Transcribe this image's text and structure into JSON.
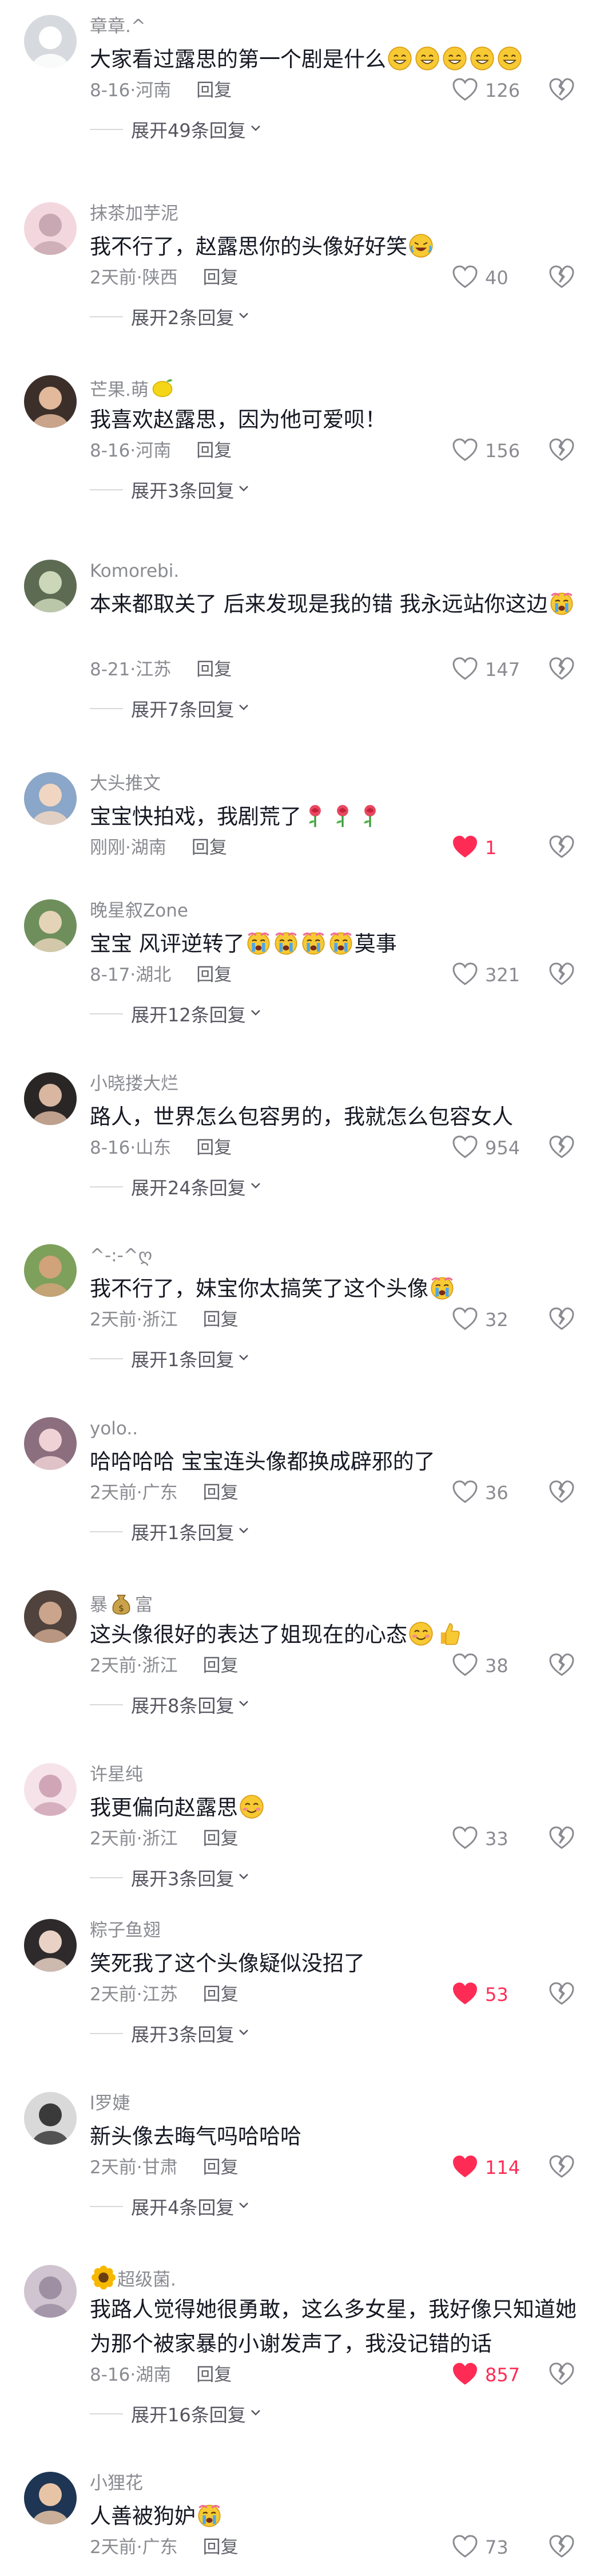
{
  "comments": [
    {
      "name": "章章.^",
      "text": "大家看过露思的第一个剧是什么",
      "emoji": [
        "grin",
        "grin",
        "grin",
        "grin",
        "grin"
      ],
      "time": "8-16",
      "region": "河南",
      "reply": "回复",
      "likes": "126",
      "liked": false,
      "expand": "展开49条回复"
    },
    {
      "name": "抹茶加芋泥",
      "text": "我不行了，赵露思你的头像好好笑",
      "emoji": [
        "rofl"
      ],
      "time": "2天前",
      "region": "陕西",
      "reply": "回复",
      "likes": "40",
      "liked": false,
      "expand": "展开2条回复"
    },
    {
      "name": "芒果.萌",
      "name_emoji": "lemon",
      "text": "我喜欢赵露思，因为他可爱呗！",
      "emoji": [],
      "time": "8-16",
      "region": "河南",
      "reply": "回复",
      "likes": "156",
      "liked": false,
      "expand": "展开3条回复"
    },
    {
      "name": "Komorebi.",
      "text": "本来都取关了 后来发现是我的错 我永远站你这边",
      "emoji": [
        "cry"
      ],
      "time": "8-21",
      "region": "江苏",
      "reply": "回复",
      "likes": "147",
      "liked": false,
      "expand": "展开7条回复"
    },
    {
      "name": "大头推文",
      "text": "宝宝快拍戏，我剧荒了",
      "emoji": [
        "rose",
        "rose",
        "rose"
      ],
      "time": "刚刚",
      "region": "湖南",
      "reply": "回复",
      "likes": "1",
      "liked": true,
      "expand": ""
    },
    {
      "name": "晚星叙Zone",
      "text": "宝宝 风评逆转了",
      "emoji": [
        "cry",
        "cry",
        "cry",
        "cry"
      ],
      "text_after": "莫事",
      "time": "8-17",
      "region": "湖北",
      "reply": "回复",
      "likes": "321",
      "liked": false,
      "expand": "展开12条回复"
    },
    {
      "name": "小晓搂大烂",
      "text": "路人，世界怎么包容男的，我就怎么包容女人",
      "emoji": [],
      "time": "8-16",
      "region": "山东",
      "reply": "回复",
      "likes": "954",
      "liked": false,
      "expand": "展开24条回复"
    },
    {
      "name": "^-:-^ღ",
      "text": "我不行了，妹宝你太搞笑了这个头像",
      "emoji": [
        "cry"
      ],
      "time": "2天前",
      "region": "浙江",
      "reply": "回复",
      "likes": "32",
      "liked": false,
      "expand": "展开1条回复"
    },
    {
      "name": "yolo..",
      "text": "哈哈哈哈 宝宝连头像都换成辟邪的了",
      "emoji": [],
      "time": "2天前",
      "region": "广东",
      "reply": "回复",
      "likes": "36",
      "liked": false,
      "expand": "展开1条回复"
    },
    {
      "name": "暴",
      "name_emoji": "moneybag",
      "name_after": "富",
      "text": "这头像很好的表达了姐现在的心态",
      "emoji": [
        "smile",
        "thumb"
      ],
      "time": "2天前",
      "region": "浙江",
      "reply": "回复",
      "likes": "38",
      "liked": false,
      "expand": "展开8条回复"
    },
    {
      "name": "许星纯",
      "text": "我更偏向赵露思",
      "emoji": [
        "smile"
      ],
      "time": "2天前",
      "region": "浙江",
      "reply": "回复",
      "likes": "33",
      "liked": false,
      "expand": "展开3条回复"
    },
    {
      "name": "粽子鱼翅",
      "text": "笑死我了这个头像疑似没招了",
      "emoji": [],
      "time": "2天前",
      "region": "江苏",
      "reply": "回复",
      "likes": "53",
      "liked": true,
      "expand": "展开3条回复"
    },
    {
      "name": "l罗婕",
      "text": "新头像去晦气吗哈哈哈",
      "emoji": [],
      "time": "2天前",
      "region": "甘肃",
      "reply": "回复",
      "likes": "114",
      "liked": true,
      "expand": "展开4条回复"
    },
    {
      "name_emoji_before": "sunflower",
      "name": "超级菌.",
      "text": "我路人觉得她很勇敢，这么多女星，我好像只知道她为那个被家暴的小谢发声了，我没记错的话",
      "emoji": [],
      "time": "8-16",
      "region": "湖南",
      "reply": "回复",
      "likes": "857",
      "liked": true,
      "expand": "展开16条回复"
    },
    {
      "name": "小狸花",
      "text": "人善被狗妒",
      "emoji": [
        "cry"
      ],
      "time": "2天前",
      "region": "广东",
      "reply": "回复",
      "likes": "73",
      "liked": false,
      "expand": ""
    }
  ],
  "colors": {
    "liked": "#fe2c55",
    "secondary": "#8a8b91",
    "text": "#161823"
  }
}
